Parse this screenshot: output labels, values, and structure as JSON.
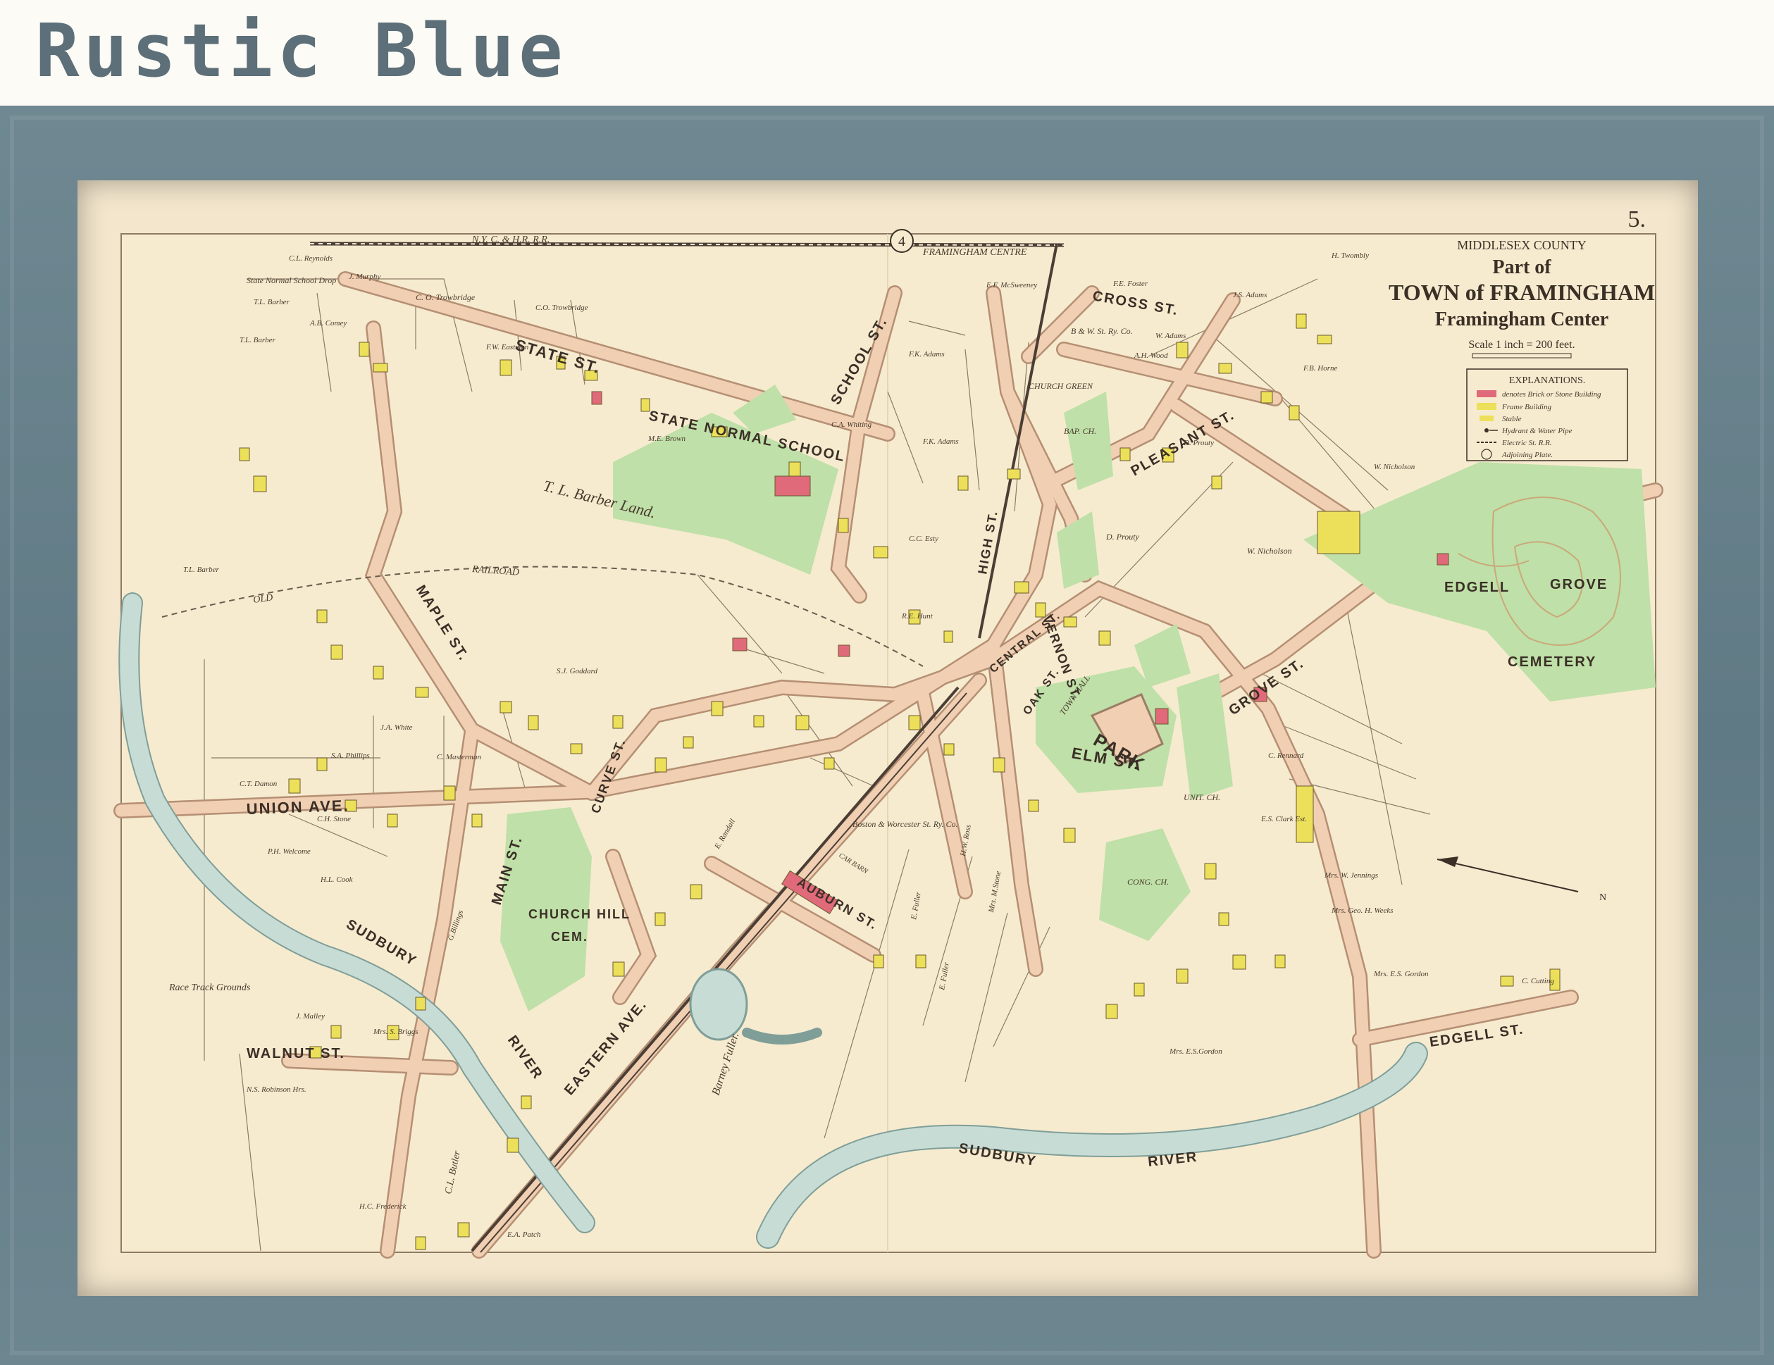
{
  "frame": {
    "label": "Rustic Blue",
    "colors": {
      "frame": "#6a838d",
      "mat": "#f3e6cc",
      "label": "#5d6f78"
    }
  },
  "map": {
    "plate_number": "5.",
    "county": "MIDDLESEX COUNTY",
    "title_line1": "Part of",
    "title_line2": "TOWN of FRAMINGHAM",
    "title_line3": "Framingham Center",
    "scale": "Scale 1 inch = 200 feet.",
    "legend": {
      "title": "EXPLANATIONS.",
      "items": [
        {
          "symbol": "brick",
          "label": "denotes Brick or Stone Building",
          "color": "#e06a7a"
        },
        {
          "symbol": "frame",
          "label": "Frame Building",
          "color": "#ece05a"
        },
        {
          "symbol": "stable",
          "label": "Stable",
          "color": "#ece05a"
        },
        {
          "symbol": "hydrant",
          "label": "Hydrant & Water Pipe"
        },
        {
          "symbol": "rail",
          "label": "Electric St. R.R."
        },
        {
          "symbol": "plate",
          "label": "Adjoining Plate."
        }
      ]
    },
    "adjoining_plate": "4",
    "colors": {
      "paper": "#f6ebcf",
      "road": "#f0cfb2",
      "road_edge": "#b58f74",
      "park": "#bfe0a8",
      "water": "#c8dcd6",
      "building": "#ece05a",
      "brick": "#e06a7a"
    },
    "streets": [
      "STATE ST.",
      "SCHOOL ST.",
      "MAPLE ST.",
      "UNION AVE.",
      "MAIN ST.",
      "CURVE ST.",
      "EASTERN AVE.",
      "AUBURN ST.",
      "ELM ST.",
      "HIGH ST.",
      "VERNON ST.",
      "CENTRAL ST.",
      "OAK ST.",
      "PLEASANT ST.",
      "CROSS ST.",
      "GROVE ST.",
      "EDGELL ST.",
      "WALNUT ST."
    ],
    "places": {
      "state_normal_school": "STATE NORMAL SCHOOL",
      "church_hill": "CHURCH HILL",
      "cem": "CEM.",
      "park": "PARK",
      "edgell": "EDGELL",
      "grove": "GROVE",
      "cemetery": "CEMETERY",
      "sudbury_river": "SUDBURY",
      "river": "RIVER",
      "sudbury_river_2": "SUDBURY",
      "river_2": "RIVER",
      "railroad_ny": "N.Y.  C.  &  H.R.  R.R.",
      "framingham_centre": "FRAMINGHAM CENTRE",
      "old_railroad": "OLD",
      "railroad": "RAILROAD",
      "barber_land": "T. L. Barber Land.",
      "race_track": "Race Track Grounds",
      "barney_fuller": "Barney Fuller.",
      "cong_ch": "CONG. CH.",
      "unit_ch": "UNIT. CH.",
      "town_hall": "TOWN HALL",
      "bap_ch": "BAP. CH.",
      "church_green": "CHURCH GREEN",
      "state_normal_school_drop": "State Normal School Drop",
      "bw_street_rr": "Boston & Worcester St. Ry. Co.",
      "bw_street_rr_2": "B & W. St. Ry. Co.",
      "car_barn": "CAR BARN"
    },
    "owners": [
      "C.L. Reynolds",
      "J. Murphy",
      "C. O. Trowbridge",
      "C.O. Trowbridge",
      "T.L. Barber",
      "T.L. Barber",
      "A.B. Comey",
      "F.W. Eastman",
      "T.L. Barber",
      "P.H. Welcome",
      "H.L. Cook",
      "C.T. Damon",
      "S.A. Phillips",
      "J.A. White",
      "C. Masterman",
      "G.Billings",
      "J. Malley",
      "Mrs. S. Briggs",
      "N.S. Robinson Hrs.",
      "H.C. Frederick",
      "E.A. Patch",
      "C.L. Butler",
      "E. Fuller",
      "E. Fuller",
      "H.W. Ross",
      "Mrs. M.Stone",
      "D. Prouty",
      "W. Nicholson",
      "W. Nicholson",
      "F.B. Horne",
      "H. Twombly",
      "E.F. McSweeney",
      "F.K. Adams",
      "F.K. Adams",
      "C.C. Esty",
      "R.E. Hunt",
      "E.S. Clark Est.",
      "Mrs. W. Jennings",
      "Mrs. Geo. H. Weeks",
      "Mrs. E.S. Gordon",
      "Mrs. E.S.Gordon",
      "C. Cutting",
      "C. Rennard",
      "E. Randall",
      "S.J. Goddard",
      "C.A. Whiting",
      "M.E. Brown",
      "D. Prouty",
      "W. Adams",
      "F.E. Foster",
      "J.S. Adams",
      "A.H. Wood",
      "C.H. Stone"
    ]
  }
}
